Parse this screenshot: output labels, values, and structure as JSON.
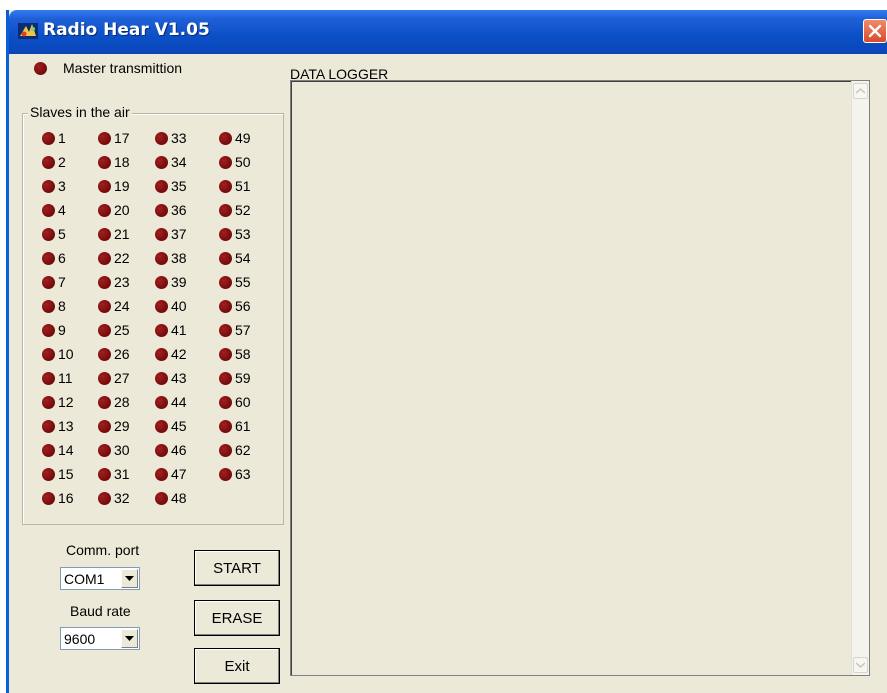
{
  "window": {
    "title": "Radio Hear V1.05"
  },
  "icons": {
    "app": "radio-app-icon",
    "close": "close-icon",
    "led": "led-indicator-icon",
    "dropdown": "chevron-down-icon"
  },
  "colors": {
    "led": "#7d0f0f",
    "titlebar": "#0b4fc7",
    "close": "#d94b2b",
    "window_bg": "#ece9d8"
  },
  "master": {
    "label": "Master transmittion"
  },
  "slaves": {
    "legend": "Slaves in the air",
    "columns": [
      [
        "1",
        "2",
        "3",
        "4",
        "5",
        "6",
        "7",
        "8",
        "9",
        "10",
        "11",
        "12",
        "13",
        "14",
        "15",
        "16"
      ],
      [
        "17",
        "18",
        "19",
        "20",
        "21",
        "22",
        "23",
        "24",
        "25",
        "26",
        "27",
        "28",
        "29",
        "30",
        "31",
        "32"
      ],
      [
        "33",
        "34",
        "35",
        "36",
        "37",
        "38",
        "39",
        "40",
        "41",
        "42",
        "43",
        "44",
        "45",
        "46",
        "47",
        "48"
      ],
      [
        "49",
        "50",
        "51",
        "52",
        "53",
        "54",
        "55",
        "56",
        "57",
        "58",
        "59",
        "60",
        "61",
        "62",
        "63"
      ]
    ]
  },
  "comm": {
    "label": "Comm. port",
    "value": "COM1"
  },
  "baud": {
    "label": "Baud rate",
    "value": "9600"
  },
  "buttons": {
    "start": "START",
    "erase": "ERASE",
    "exit": "Exit"
  },
  "logger": {
    "title": "DATA LOGGER"
  }
}
